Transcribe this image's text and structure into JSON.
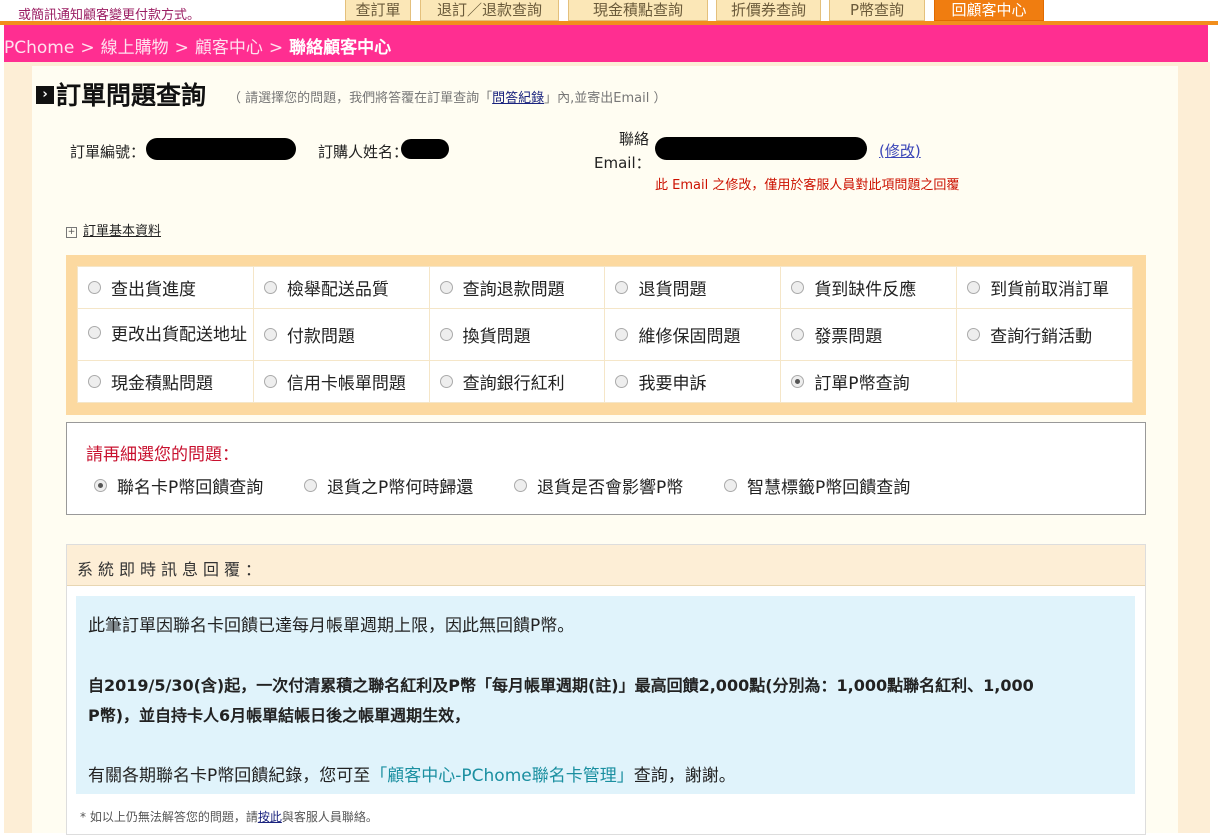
{
  "top": {
    "notice": "或簡訊通知顧客變更付款方式。",
    "tabs": [
      {
        "label": "查訂單"
      },
      {
        "label": "退訂／退款查詢"
      },
      {
        "label": "現金積點查詢"
      },
      {
        "label": "折價券查詢"
      },
      {
        "label": "P幣查詢"
      },
      {
        "label": "回顧客中心"
      }
    ]
  },
  "breadcrumb": {
    "items": [
      "PChome",
      "線上購物",
      "顧客中心"
    ],
    "current": "聯絡顧客中心",
    "separator": ">"
  },
  "header": {
    "title": "訂單問題查詢",
    "note_pre": "（ 請選擇您的問題，我們將答覆在訂單查詢「",
    "note_link": "問答紀錄",
    "note_post": "」內,並寄出Email ）"
  },
  "order_info": {
    "order_no_label": "訂單編號：",
    "buyer_label": "訂購人姓名：",
    "email_label_1": "聯絡",
    "email_label_2": "Email：",
    "edit_label": "(修改)",
    "email_note": "此 Email 之修改，僅用於客服人員對此項問題之回覆"
  },
  "order_basic": {
    "label": "訂單基本資料"
  },
  "questions": {
    "rows": [
      [
        "查出貨進度",
        "檢舉配送品質",
        "查詢退款問題",
        "退貨問題",
        "貨到缺件反應",
        "到貨前取消訂單"
      ],
      [
        "更改出貨配送地址",
        "付款問題",
        "換貨問題",
        "維修保固問題",
        "發票問題",
        "查詢行銷活動"
      ],
      [
        "現金積點問題",
        "信用卡帳單問題",
        "查詢銀行紅利",
        "我要申訴",
        "訂單P幣查詢",
        ""
      ]
    ],
    "selected": "訂單P幣查詢"
  },
  "sub_question": {
    "title": "請再細選您的問題：",
    "options": [
      "聯名卡P幣回饋查詢",
      "退貨之P幣何時歸還",
      "退貨是否會影響P幣",
      "智慧標籤P幣回饋查詢"
    ],
    "selected": "聯名卡P幣回饋查詢"
  },
  "response": {
    "title": "系統即時訊息回覆：",
    "p1": "此筆訂單因聯名卡回饋已達每月帳單週期上限，因此無回饋P幣。",
    "p2_line1": "自2019/5/30(含)起，一次付清累積之聯名紅利及P幣「每月帳單週期(註)」最高回饋2,000點(分別為：1,000點聯名紅利、1,000",
    "p2_line2": "P幣)，並自持卡人6月帳單結帳日後之帳單週期生效，",
    "p3_pre": "有關各期聯名卡P幣回饋紀錄，您可至",
    "p3_link": "「顧客中心-PChome聯名卡管理」",
    "p3_post": "查詢，謝謝。"
  },
  "footnote": {
    "pre": "* 如以上仍無法解答您的問題，請",
    "link": "按此",
    "post": "與客服人員聯絡。"
  }
}
